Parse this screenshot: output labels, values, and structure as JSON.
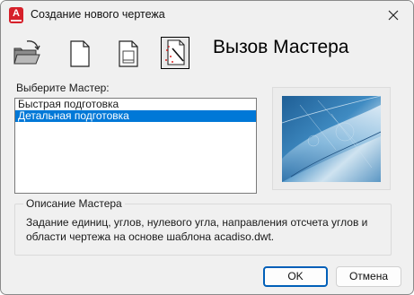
{
  "window": {
    "title": "Создание нового чертежа",
    "app_icon_letter": "A"
  },
  "toolbar": {
    "buttons": [
      {
        "name": "open-drawing",
        "icon": "folder-open-icon",
        "selected": false
      },
      {
        "name": "start-from-scratch",
        "icon": "blank-page-icon",
        "selected": false
      },
      {
        "name": "use-template",
        "icon": "template-page-icon",
        "selected": false
      },
      {
        "name": "use-wizard",
        "icon": "wizard-page-icon",
        "selected": true
      }
    ]
  },
  "section_title": "Вызов Мастера",
  "wizard_list": {
    "label": "Выберите Мастер:",
    "items": [
      "Быстрая подготовка",
      "Детальная подготовка"
    ],
    "selected_index": 1
  },
  "preview": {
    "icon": "blueprint-preview-image"
  },
  "description": {
    "legend": "Описание Мастера",
    "text": "Задание единиц, углов, нулевого угла, направления отсчета углов и области чертежа на основе шаблона acadiso.dwt."
  },
  "buttons": {
    "ok": "OK",
    "cancel": "Отмена"
  },
  "colors": {
    "selection": "#0078d7",
    "accent": "#005fb8",
    "app_icon": "#d6202a"
  }
}
